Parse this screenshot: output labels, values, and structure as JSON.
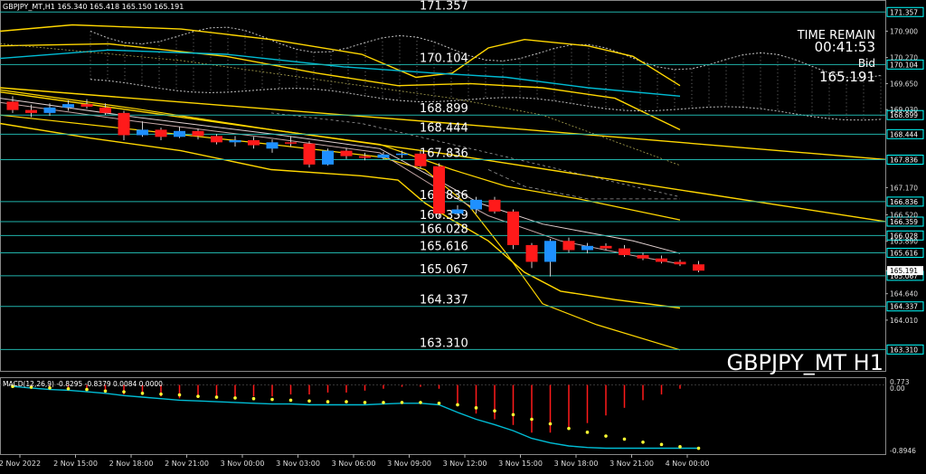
{
  "header": {
    "info": "GBPJPY_MT,H1  165.340 165.418 165.150 165.191"
  },
  "overlay": {
    "time_remain_label": "TIME REMAIN",
    "time_remain_value": "00:41:53",
    "bid_label": "Bid",
    "bid_value": "165.191",
    "symbol_watermark": "GBPJPY_MT H1"
  },
  "macd": {
    "label": "MACD(12,26,9) -0.8295 -0.8379 0.0084 0.0000",
    "scale_top": "0.773",
    "scale_zero": "0.00",
    "scale_bottom": "-0.8946"
  },
  "colors": {
    "background": "#000000",
    "bull": "#1e90ff",
    "bear": "#ff1a1a",
    "level_line": "#20b2aa",
    "yellow": "#ffd700",
    "cyan_ma": "#00bcd4",
    "cloud": "#c0c0c0",
    "signal_dots": "#ffff33",
    "price_box": "#00ffff"
  },
  "chart_data": {
    "type": "candlestick",
    "symbol": "GBPJPY_MT",
    "timeframe": "H1",
    "y_range": [
      162.8,
      171.6
    ],
    "price_axis_ticks": [
      "171.357",
      "170.900",
      "170.270",
      "170.104",
      "169.650",
      "169.030",
      "168.899",
      "168.444",
      "167.836",
      "167.170",
      "166.836",
      "166.520",
      "166.359",
      "166.028",
      "165.890",
      "165.616",
      "165.191",
      "165.067",
      "164.640",
      "164.337",
      "164.010",
      "163.310"
    ],
    "levels": [
      {
        "value": 171.357,
        "label": "171.357"
      },
      {
        "value": 170.104,
        "label": "170.104"
      },
      {
        "value": 168.899,
        "label": "168.899"
      },
      {
        "value": 168.444,
        "label": "168.444"
      },
      {
        "value": 167.836,
        "label": "167.836"
      },
      {
        "value": 166.836,
        "label": "166.836"
      },
      {
        "value": 166.359,
        "label": "166.359"
      },
      {
        "value": 166.028,
        "label": "166.028"
      },
      {
        "value": 165.616,
        "label": "165.616"
      },
      {
        "value": 165.067,
        "label": "165.067"
      },
      {
        "value": 164.337,
        "label": "164.337"
      },
      {
        "value": 163.31,
        "label": "163.310"
      }
    ],
    "current_price": 165.191,
    "time_labels": [
      "2 Nov 2022",
      "2 Nov 15:00",
      "2 Nov 18:00",
      "2 Nov 21:00",
      "3 Nov 00:00",
      "3 Nov 03:00",
      "3 Nov 06:00",
      "3 Nov 09:00",
      "3 Nov 12:00",
      "3 Nov 15:00",
      "3 Nov 18:00",
      "3 Nov 21:00",
      "4 Nov 00:00"
    ],
    "candles": [
      {
        "o": 169.22,
        "h": 169.35,
        "l": 168.95,
        "c": 169.02
      },
      {
        "o": 169.02,
        "h": 169.15,
        "l": 168.85,
        "c": 168.95
      },
      {
        "o": 168.95,
        "h": 169.18,
        "l": 168.88,
        "c": 169.08
      },
      {
        "o": 169.08,
        "h": 169.25,
        "l": 169.0,
        "c": 169.16
      },
      {
        "o": 169.16,
        "h": 169.28,
        "l": 169.05,
        "c": 169.1
      },
      {
        "o": 169.08,
        "h": 169.18,
        "l": 168.9,
        "c": 168.95
      },
      {
        "o": 168.95,
        "h": 169.0,
        "l": 168.3,
        "c": 168.42
      },
      {
        "o": 168.42,
        "h": 168.75,
        "l": 168.38,
        "c": 168.55
      },
      {
        "o": 168.55,
        "h": 168.6,
        "l": 168.3,
        "c": 168.38
      },
      {
        "o": 168.38,
        "h": 168.62,
        "l": 168.35,
        "c": 168.52
      },
      {
        "o": 168.52,
        "h": 168.58,
        "l": 168.32,
        "c": 168.4
      },
      {
        "o": 168.4,
        "h": 168.45,
        "l": 168.2,
        "c": 168.25
      },
      {
        "o": 168.25,
        "h": 168.4,
        "l": 168.15,
        "c": 168.3
      },
      {
        "o": 168.3,
        "h": 168.38,
        "l": 168.1,
        "c": 168.18
      },
      {
        "o": 168.1,
        "h": 168.32,
        "l": 168.0,
        "c": 168.25
      },
      {
        "o": 168.25,
        "h": 168.4,
        "l": 168.15,
        "c": 168.22
      },
      {
        "o": 168.22,
        "h": 168.28,
        "l": 167.65,
        "c": 167.72
      },
      {
        "o": 167.72,
        "h": 168.1,
        "l": 167.7,
        "c": 168.05
      },
      {
        "o": 168.05,
        "h": 168.12,
        "l": 167.85,
        "c": 167.92
      },
      {
        "o": 167.92,
        "h": 168.0,
        "l": 167.82,
        "c": 167.88
      },
      {
        "o": 167.88,
        "h": 168.02,
        "l": 167.84,
        "c": 167.96
      },
      {
        "o": 167.96,
        "h": 168.05,
        "l": 167.88,
        "c": 167.98
      },
      {
        "o": 167.98,
        "h": 168.05,
        "l": 167.62,
        "c": 167.68
      },
      {
        "o": 167.68,
        "h": 167.75,
        "l": 166.45,
        "c": 166.55
      },
      {
        "o": 166.55,
        "h": 166.75,
        "l": 166.5,
        "c": 166.65
      },
      {
        "o": 166.65,
        "h": 166.95,
        "l": 166.55,
        "c": 166.88
      },
      {
        "o": 166.88,
        "h": 166.95,
        "l": 166.55,
        "c": 166.6
      },
      {
        "o": 166.6,
        "h": 166.65,
        "l": 165.7,
        "c": 165.8
      },
      {
        "o": 165.8,
        "h": 165.85,
        "l": 165.25,
        "c": 165.4
      },
      {
        "o": 165.4,
        "h": 165.95,
        "l": 165.05,
        "c": 165.9
      },
      {
        "o": 165.9,
        "h": 165.98,
        "l": 165.62,
        "c": 165.68
      },
      {
        "o": 165.68,
        "h": 165.85,
        "l": 165.6,
        "c": 165.78
      },
      {
        "o": 165.78,
        "h": 165.84,
        "l": 165.68,
        "c": 165.72
      },
      {
        "o": 165.72,
        "h": 165.8,
        "l": 165.52,
        "c": 165.56
      },
      {
        "o": 165.56,
        "h": 165.62,
        "l": 165.44,
        "c": 165.48
      },
      {
        "o": 165.48,
        "h": 165.55,
        "l": 165.36,
        "c": 165.4
      },
      {
        "o": 165.4,
        "h": 165.45,
        "l": 165.3,
        "c": 165.34
      },
      {
        "o": 165.34,
        "h": 165.42,
        "l": 165.15,
        "c": 165.19
      }
    ],
    "macd_line": [
      -0.02,
      -0.04,
      -0.06,
      -0.07,
      -0.09,
      -0.11,
      -0.14,
      -0.16,
      -0.18,
      -0.2,
      -0.21,
      -0.22,
      -0.23,
      -0.24,
      -0.25,
      -0.25,
      -0.26,
      -0.26,
      -0.26,
      -0.26,
      -0.25,
      -0.24,
      -0.24,
      -0.26,
      -0.36,
      -0.45,
      -0.52,
      -0.6,
      -0.7,
      -0.76,
      -0.8,
      -0.82,
      -0.83,
      -0.83,
      -0.83,
      -0.83,
      -0.83,
      -0.83
    ],
    "signal_line": [
      -0.02,
      -0.03,
      -0.04,
      -0.05,
      -0.06,
      -0.08,
      -0.09,
      -0.11,
      -0.12,
      -0.13,
      -0.15,
      -0.16,
      -0.17,
      -0.18,
      -0.19,
      -0.2,
      -0.21,
      -0.22,
      -0.22,
      -0.23,
      -0.23,
      -0.23,
      -0.23,
      -0.24,
      -0.26,
      -0.3,
      -0.34,
      -0.39,
      -0.45,
      -0.51,
      -0.57,
      -0.62,
      -0.67,
      -0.71,
      -0.75,
      -0.78,
      -0.81,
      -0.83
    ],
    "macd_ylim": [
      -0.8946,
      0.0773
    ]
  }
}
